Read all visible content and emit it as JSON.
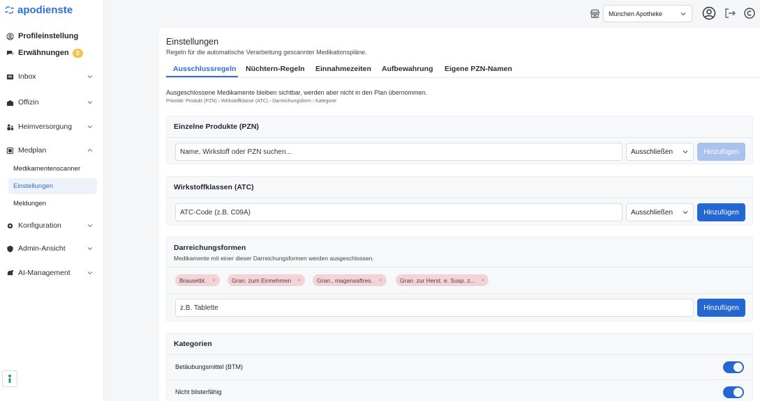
{
  "app": {
    "logo_text": "apodienste",
    "brand_color": "#2c6fd6"
  },
  "sidebar": {
    "top_items": [
      {
        "label": "Profileinstellung",
        "icon": "user-circle-icon"
      },
      {
        "label": "Erwähnungen",
        "icon": "chat-icon",
        "badge": "0"
      }
    ],
    "items": [
      {
        "label": "Inbox",
        "icon": "inbox-icon"
      },
      {
        "label": "Offizin",
        "icon": "store-icon"
      },
      {
        "label": "Heimversorgung",
        "icon": "people-icon"
      },
      {
        "label": "Medplan",
        "icon": "scan-icon",
        "expanded": true
      }
    ],
    "sub_items": [
      {
        "label": "Medikamentenscanner"
      },
      {
        "label": "Einstellungen",
        "active": true
      },
      {
        "label": "Meldungen"
      }
    ],
    "bottom_items": [
      {
        "label": "Konfiguration",
        "icon": "gear-icon"
      },
      {
        "label": "Admin-Ansicht",
        "icon": "shield-icon"
      },
      {
        "label": "AI-Management",
        "icon": "ai-icon"
      }
    ]
  },
  "topbar": {
    "store_value": "München Apotheke"
  },
  "page": {
    "title": "Einstellungen",
    "subtitle": "Regeln für die automatische Verarbeitung gescannter Medikationspläne.",
    "tabs": [
      {
        "label": "Ausschlussregeln",
        "active": true
      },
      {
        "label": "Nüchtern-Regeln"
      },
      {
        "label": "Einnahmezeiten"
      },
      {
        "label": "Aufbewahrung"
      },
      {
        "label": "Eigene PZN-Namen"
      }
    ],
    "info": "Ausgeschlossene Medikamente bleiben sichtbar, werden aber nicht in den Plan übernommen.",
    "priority": "Priorität: Produkt (PZN) › Wirkstoffklasse (ATC) › Darreichungsform › Kategorie"
  },
  "pzn": {
    "title": "Einzelne Produkte (PZN)",
    "placeholder": "Name, Wirkstoff oder PZN suchen...",
    "select_value": "Ausschließen",
    "button": "Hinzufügen"
  },
  "atc": {
    "title": "Wirkstoffklassen (ATC)",
    "placeholder": "ATC-Code (z.B. C09A)",
    "select_value": "Ausschließen",
    "button": "Hinzufügen"
  },
  "forms": {
    "title": "Darreichungsformen",
    "description": "Medikamente mit einer dieser Darreichungsformen werden ausgeschlossen.",
    "chips": [
      "Brausetbl.",
      "Gran. zum Einnehmen",
      "Gran., magensaftres.",
      "Gran. zur Herst. e. Susp. z..."
    ],
    "placeholder": "z.B. Tablette",
    "button": "Hinzufügen"
  },
  "categories": {
    "title": "Kategorien",
    "items": [
      {
        "label": "Betäubungsmittel (BTM)",
        "enabled": true
      },
      {
        "label": "Nicht blisterfähig",
        "enabled": true
      }
    ]
  }
}
